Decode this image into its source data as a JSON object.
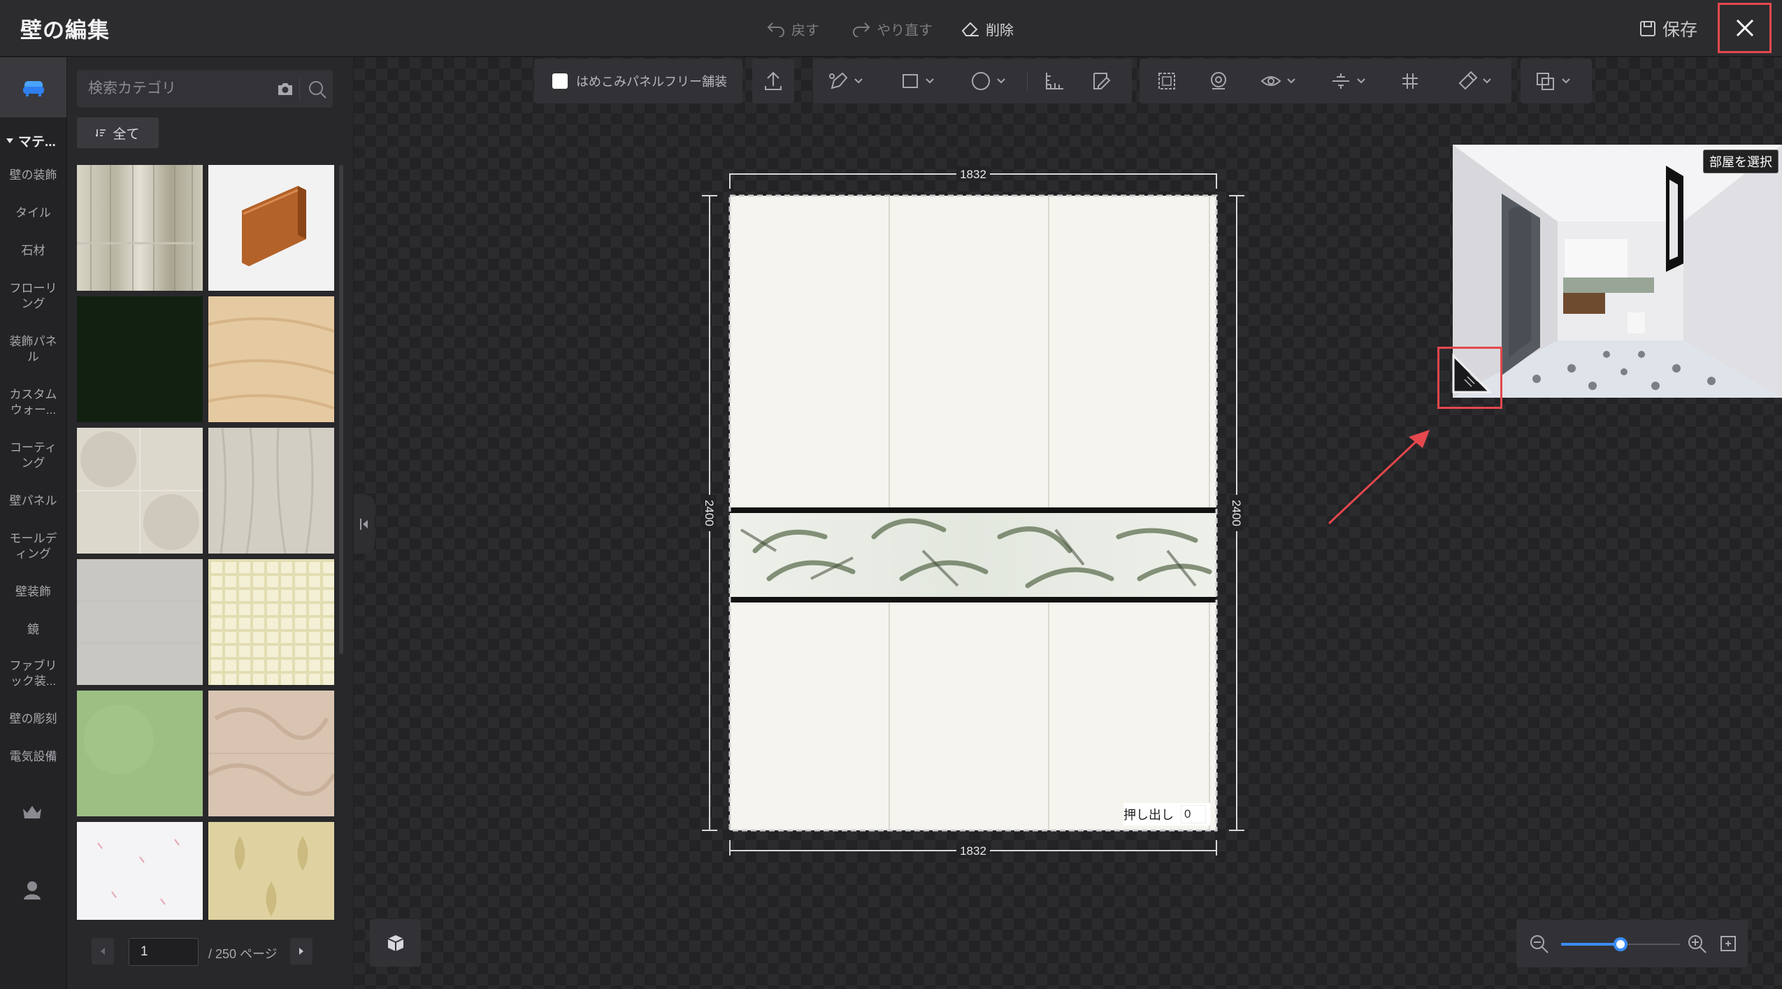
{
  "window": {
    "title": "壁の編集"
  },
  "topbar": {
    "undo": "戻す",
    "redo": "やり直す",
    "delete": "削除",
    "save": "保存"
  },
  "sidebar": {
    "section": "マテ...",
    "items": [
      "壁の装飾",
      "タイル",
      "石材",
      "フローリング",
      "装飾パネル",
      "カスタムウォー...",
      "コーティング",
      "壁パネル",
      "モールディング",
      "壁装飾",
      "鏡",
      "ファブリック装...",
      "壁の彫刻",
      "電気設備"
    ]
  },
  "materials": {
    "search_placeholder": "検索カテゴリ",
    "filter_all": "全て",
    "tiles": [
      "birch-wood",
      "wood-skirting",
      "dark-green",
      "light-oak",
      "marble-beige",
      "whitewash-wood",
      "grey-linen",
      "plaid-check",
      "sage-green",
      "beige-marble",
      "floral-white",
      "damask-gold"
    ]
  },
  "pagination": {
    "current": "1",
    "total": "/ 250 ページ"
  },
  "toolbar": {
    "seamless_label": "はめこみパネルフリー舗装"
  },
  "wall": {
    "width_top": "1832",
    "width_bottom": "1832",
    "height_left": "2400",
    "height_right": "2400",
    "extrude_label": "押し出し",
    "extrude_value": "0"
  },
  "preview": {
    "room_select": "部屋を選択"
  },
  "zoom": {
    "level": 0.5
  },
  "colors": {
    "accent": "#3b8cf7",
    "highlight": "#e5484d",
    "wall": "#f6f4ee"
  }
}
